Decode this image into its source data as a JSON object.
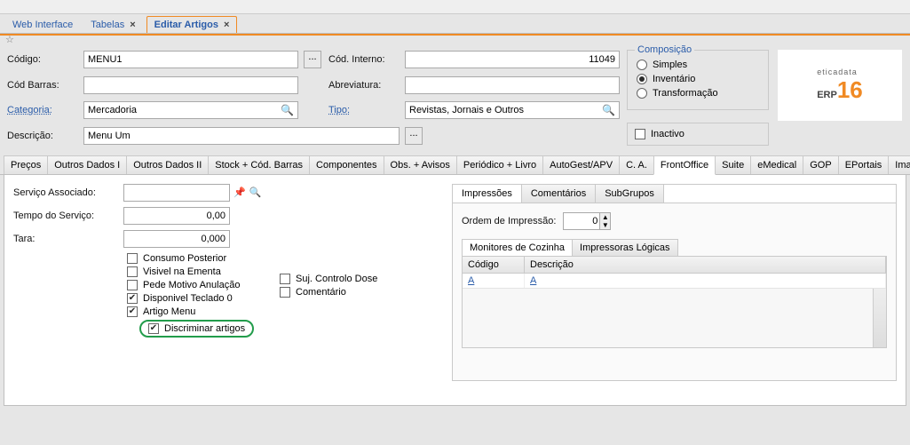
{
  "top_tabs": {
    "web": "Web Interface",
    "tabelas": "Tabelas",
    "editar": "Editar Artigos"
  },
  "form": {
    "codigo_lbl": "Código:",
    "codigo_val": "MENU1",
    "codint_lbl": "Cód. Interno:",
    "codint_val": "11049",
    "codbarras_lbl": "Cód Barras:",
    "codbarras_val": "",
    "abrev_lbl": "Abreviatura:",
    "abrev_val": "",
    "categoria_lbl": "Categoria:",
    "categoria_val": "Mercadoria",
    "tipo_lbl": "Tipo:",
    "tipo_val": "Revistas, Jornais e Outros",
    "descricao_lbl": "Descrição:",
    "descricao_val": "Menu Um"
  },
  "composicao": {
    "legend": "Composição",
    "simples": "Simples",
    "inventario": "Inventário",
    "transformacao": "Transformação",
    "selected": "inventario",
    "inactivo": "Inactivo"
  },
  "logo": {
    "line1": "eticadata",
    "line2a": "ERP",
    "line2b": "16"
  },
  "main_tabs": [
    "Preços",
    "Outros Dados I",
    "Outros Dados II",
    "Stock + Cód. Barras",
    "Componentes",
    "Obs. + Avisos",
    "Periódico + Livro",
    "AutoGest/APV",
    "C. A.",
    "FrontOffice",
    "Suite",
    "eMedical",
    "GOP",
    "EPortais",
    "Imagens"
  ],
  "main_tabs_active": 9,
  "frontoffice": {
    "servico_lbl": "Serviço Associado:",
    "tempo_lbl": "Tempo do Serviço:",
    "tempo_val": "0,00",
    "tara_lbl": "Tara:",
    "tara_val": "0,000",
    "chk": {
      "consumo": "Consumo Posterior",
      "visivel": "Visivel na Ementa",
      "motivo": "Pede Motivo Anulação",
      "disponivel": "Disponivel Teclado 0",
      "artigo_menu": "Artigo Menu",
      "discriminar": "Discriminar artigos",
      "suj": "Suj. Controlo Dose",
      "comentario": "Comentário"
    }
  },
  "sub_tabs": {
    "imp": "Impressões",
    "com": "Comentários",
    "sub": "SubGrupos"
  },
  "ordem_lbl": "Ordem de Impressão:",
  "ordem_val": "0",
  "inner_tabs": {
    "mon": "Monitores de Cozinha",
    "imp": "Impressoras Lógicas"
  },
  "grid": {
    "codigo": "Código",
    "descricao": "Descrição",
    "cell": "A"
  },
  "chart_data": null
}
